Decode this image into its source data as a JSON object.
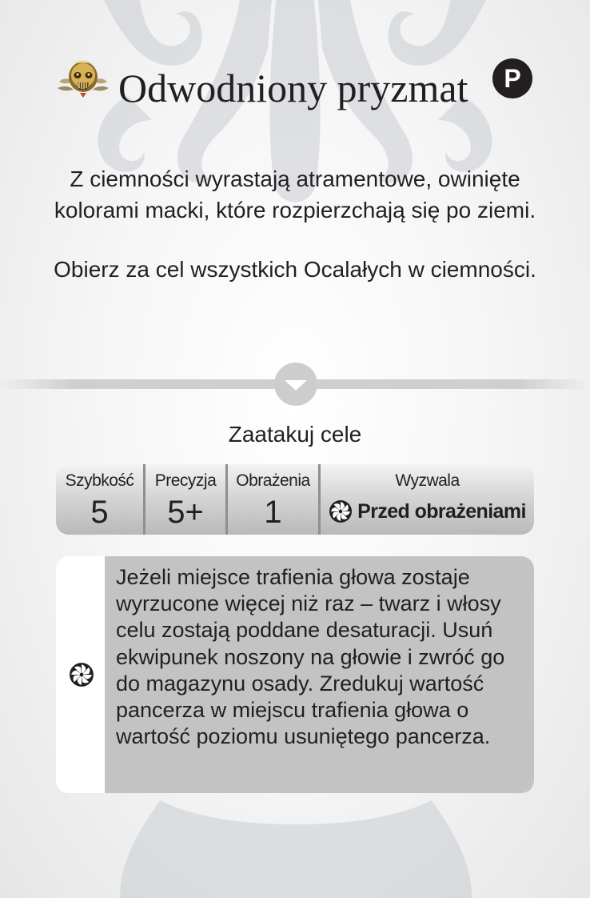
{
  "card": {
    "title": "Odwodniony pryzmat",
    "badge": "P",
    "flavor_text": "Z ciemności wyrastają atramentowe, owinięte kolorami macki, które rozpierzchają się po ziemi.",
    "instruction": "Obierz za cel wszystkich Ocalałych w ciemności.",
    "action_label": "Zaatakuj cele",
    "stats": {
      "speed_label": "Szybkość",
      "speed_value": "5",
      "accuracy_label": "Precyzja",
      "accuracy_value": "5+",
      "damage_label": "Obrażenia",
      "damage_value": "1",
      "trigger_label": "Wyzwala",
      "trigger_value": "Przed obrażeniami"
    },
    "effect_text": "Jeżeli miejsce trafienia głowa zostaje wyrzucone więcej niż raz – twarz i włosy celu zostają poddane desaturacji. Usuń ekwipunek noszony na głowie i zwróć go do magazynu osady. Zredukuj wartość pancerza w miejscu trafienia głowa o wartość poziomu usuniętego pancerza."
  },
  "icons": {
    "title_icon": "ornate-gold-skull-icon",
    "trigger_icon": "pinwheel-icon",
    "effect_icon": "pinwheel-icon",
    "divider_icon": "chevron-down-icon"
  },
  "colors": {
    "text": "#231f20",
    "stat_bar": "#d0d0d0",
    "effect_panel": "#c3c3c3"
  }
}
